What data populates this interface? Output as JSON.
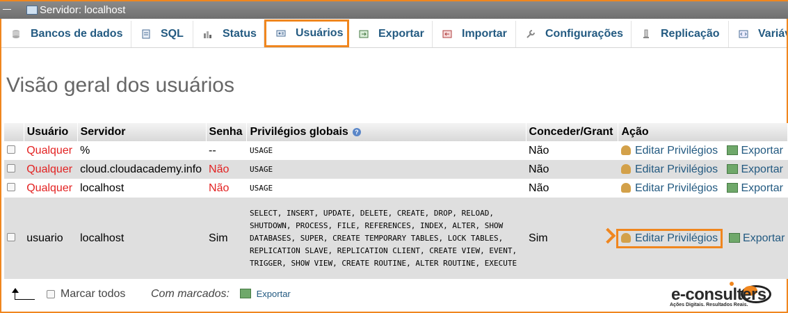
{
  "topbar": {
    "title": "Servidor: localhost"
  },
  "tabs": [
    {
      "label": "Bancos de dados",
      "icon": "database-icon"
    },
    {
      "label": "SQL",
      "icon": "sql-icon"
    },
    {
      "label": "Status",
      "icon": "status-icon"
    },
    {
      "label": "Usuários",
      "icon": "users-icon",
      "active": true
    },
    {
      "label": "Exportar",
      "icon": "export-icon"
    },
    {
      "label": "Importar",
      "icon": "import-icon"
    },
    {
      "label": "Configurações",
      "icon": "wrench-icon"
    },
    {
      "label": "Replicação",
      "icon": "replication-icon"
    },
    {
      "label": "Variáv",
      "icon": "variables-icon"
    }
  ],
  "page": {
    "title": "Visão geral dos usuários"
  },
  "table": {
    "headers": [
      "Usuário",
      "Servidor",
      "Senha",
      "Privilégios globais",
      "Conceder/Grant",
      "Ação"
    ],
    "rows": [
      {
        "user": "Qualquer",
        "host": "%",
        "password": "--",
        "privileges": "USAGE",
        "grant": "Não",
        "edit": "Editar Privilégios",
        "export": "Exportar"
      },
      {
        "user": "Qualquer",
        "host": "cloud.cloudacademy.info",
        "password": "Não",
        "privileges": "USAGE",
        "grant": "Não",
        "edit": "Editar Privilégios",
        "export": "Exportar"
      },
      {
        "user": "Qualquer",
        "host": "localhost",
        "password": "Não",
        "privileges": "USAGE",
        "grant": "Não",
        "edit": "Editar Privilégios",
        "export": "Exportar"
      },
      {
        "user": "usuario",
        "host": "localhost",
        "password": "Sim",
        "privileges": "SELECT, INSERT, UPDATE, DELETE, CREATE, DROP, RELOAD, SHUTDOWN, PROCESS, FILE, REFERENCES, INDEX, ALTER, SHOW DATABASES, SUPER, CREATE TEMPORARY TABLES, LOCK TABLES, REPLICATION SLAVE, REPLICATION CLIENT, CREATE VIEW, EVENT, TRIGGER, SHOW VIEW, CREATE ROUTINE, ALTER ROUTINE, EXECUTE",
        "grant": "Sim",
        "edit": "Editar Privilégios",
        "export": "Exportar"
      }
    ]
  },
  "footer": {
    "check_all": "Marcar todos",
    "with_selected": "Com marcados:",
    "export": "Exportar"
  },
  "logo": {
    "text": "e-consulters",
    "tagline": "Ações Digitais. Resultados Reais."
  },
  "colors": {
    "accent": "#f0861e",
    "link": "#235a81",
    "red": "#e32222"
  }
}
